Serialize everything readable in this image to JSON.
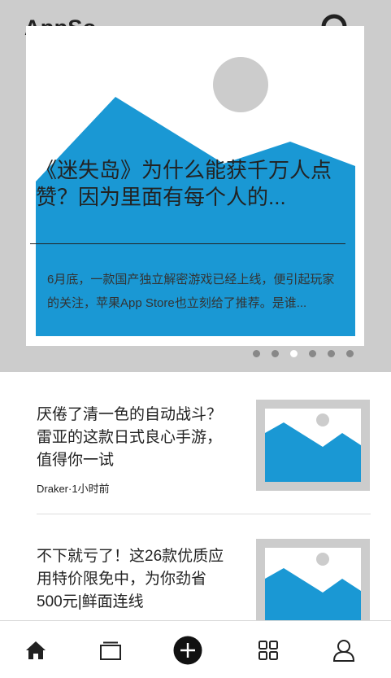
{
  "header": {
    "app_title": "AppSo",
    "search_icon": "search-icon"
  },
  "hero": {
    "headline": "《迷失岛》为什么能获千万人点赞？因为里面有每个人的...",
    "summary": "6月底，一款国产独立解密游戏已经上线，便引起玩家的关注，苹果App Store也立刻给了推荐。是谁...",
    "pagination": {
      "total": 6,
      "active": 3
    }
  },
  "articles": [
    {
      "title": "厌倦了清一色的自动战斗？雷亚的这款日式良心手游，值得你一试",
      "meta": "Draker·1小时前"
    },
    {
      "title": "不下就亏了！这26款优质应用特价限免中，为你劲省500元|鲜面连线",
      "meta": ""
    }
  ],
  "tabbar": {
    "items": [
      {
        "icon": "home-icon"
      },
      {
        "icon": "cards-icon"
      },
      {
        "icon": "add-icon"
      },
      {
        "icon": "apps-grid-icon"
      },
      {
        "icon": "profile-icon"
      }
    ]
  },
  "colors": {
    "accent": "#1a98d4",
    "placeholder_gray": "#cccccc",
    "text": "#222222"
  }
}
